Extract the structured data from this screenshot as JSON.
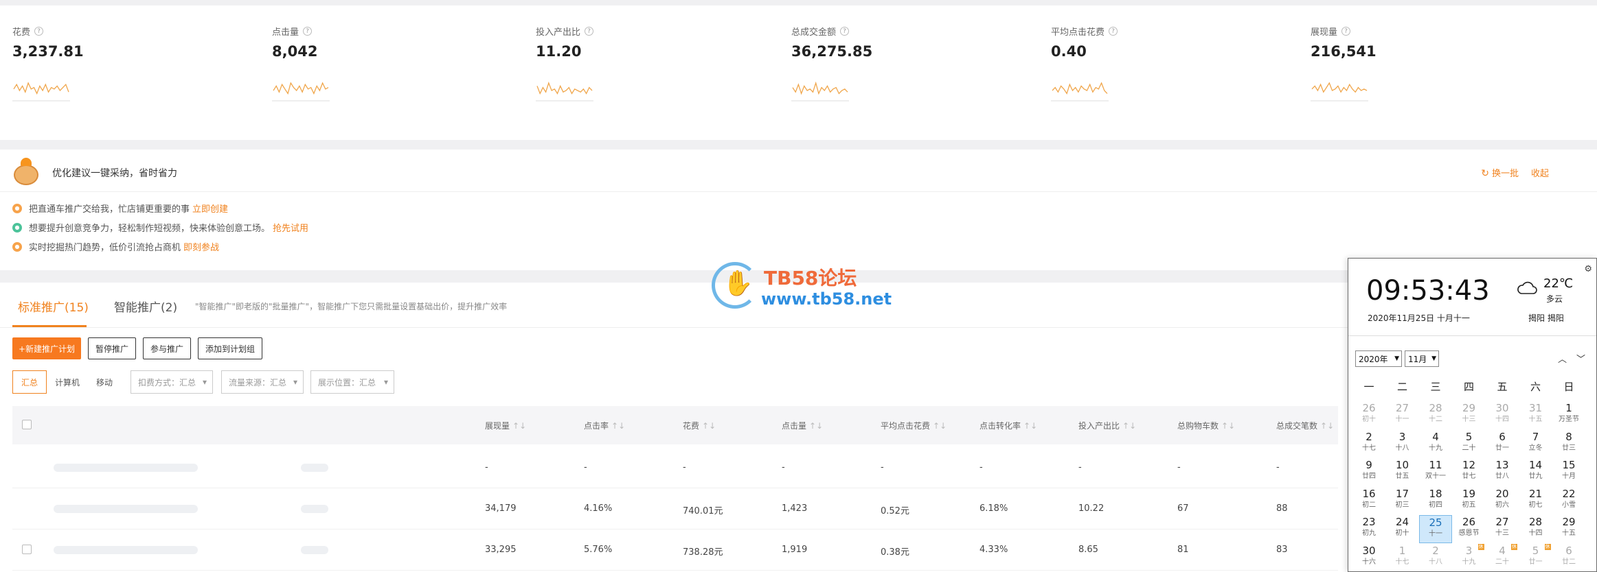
{
  "metrics": [
    {
      "label": "花费",
      "value": "3,237.81",
      "spark": [
        6,
        9,
        5,
        8,
        4,
        10,
        6,
        7,
        3,
        8,
        5,
        9,
        4,
        7,
        6,
        8,
        5,
        7,
        9,
        4
      ]
    },
    {
      "label": "点击量",
      "value": "8,042",
      "spark": [
        5,
        8,
        4,
        9,
        6,
        3,
        10,
        7,
        5,
        8,
        4,
        9,
        6,
        7,
        3,
        8,
        5,
        10,
        6,
        7
      ]
    },
    {
      "label": "投入产出比",
      "value": "11.20",
      "spark": [
        8,
        3,
        7,
        4,
        10,
        5,
        6,
        3,
        8,
        4,
        5,
        7,
        3,
        6,
        5,
        4,
        6,
        3,
        7,
        5
      ]
    },
    {
      "label": "总成交金额",
      "value": "36,275.85",
      "spark": [
        7,
        4,
        9,
        3,
        8,
        5,
        6,
        4,
        10,
        3,
        7,
        5,
        8,
        4,
        6,
        7,
        3,
        5,
        6,
        4
      ]
    },
    {
      "label": "平均点击花费",
      "value": "0.40",
      "spark": [
        5,
        7,
        4,
        8,
        6,
        3,
        9,
        5,
        7,
        4,
        8,
        6,
        5,
        9,
        4,
        7,
        6,
        10,
        5,
        3
      ]
    },
    {
      "label": "展现量",
      "value": "216,541",
      "spark": [
        6,
        8,
        5,
        9,
        4,
        7,
        10,
        5,
        6,
        8,
        4,
        7,
        5,
        9,
        6,
        4,
        7,
        5,
        6,
        5
      ]
    }
  ],
  "suggest": {
    "title": "优化建议一键采纳，省时省力",
    "refresh": "换一批",
    "collapse": "收起",
    "items": [
      {
        "text": "把直通车推广交给我，忙店铺更重要的事",
        "link": "立即创建"
      },
      {
        "text": "想要提升创意竞争力，轻松制作短视频，快来体验创意工场。",
        "link": "抢先试用"
      },
      {
        "text": "实时挖掘热门趋势，低价引流抢占商机",
        "link": "即刻参战"
      }
    ]
  },
  "tabs": {
    "standard": "标准推广(15)",
    "smart": "智能推广(2)",
    "note": "\"智能推广\"即老版的\"批量推广\"，智能推广下您只需批量设置基础出价，提升推广效率"
  },
  "buttons": {
    "new": "+新建推广计划",
    "pause": "暂停推广",
    "join": "参与推广",
    "add_label": "添加到计划组"
  },
  "filters": {
    "segments": [
      "汇总",
      "计算机",
      "移动"
    ],
    "deduct": "扣费方式：汇总",
    "source": "流量来源：汇总",
    "position": "展示位置：汇总"
  },
  "table": {
    "columns": [
      "展现量",
      "点击率",
      "花费",
      "点击量",
      "平均点击花费",
      "点击转化率",
      "投入产出比",
      "总购物车数",
      "总成交笔数"
    ],
    "sort": "↑↓",
    "rows": [
      [
        "-",
        "-",
        "-",
        "-",
        "-",
        "-",
        "-",
        "-",
        "-"
      ],
      [
        "34,179",
        "4.16%",
        "740.01元",
        "1,423",
        "0.52元",
        "6.18%",
        "10.22",
        "67",
        "88"
      ],
      [
        "33,295",
        "5.76%",
        "738.28元",
        "1,919",
        "0.38元",
        "4.33%",
        "8.65",
        "81",
        "83"
      ]
    ]
  },
  "watermark": {
    "title": "TB58论坛",
    "url": "www.tb58.net"
  },
  "calendar": {
    "time": "09:53:43",
    "date": "2020年11月25日  十月十一",
    "temp": "22℃",
    "cond": "多云",
    "loc": "揭阳 揭阳",
    "year_sel": "2020年",
    "month_sel": "11月",
    "weekdays": [
      "一",
      "二",
      "三",
      "四",
      "五",
      "六",
      "日"
    ],
    "days": [
      {
        "n": "26",
        "l": "初十",
        "dim": true
      },
      {
        "n": "27",
        "l": "十一",
        "dim": true
      },
      {
        "n": "28",
        "l": "十二",
        "dim": true
      },
      {
        "n": "29",
        "l": "十三",
        "dim": true
      },
      {
        "n": "30",
        "l": "十四",
        "dim": true
      },
      {
        "n": "31",
        "l": "十五",
        "dim": true
      },
      {
        "n": "1",
        "l": "万圣节"
      },
      {
        "n": "2",
        "l": "十七"
      },
      {
        "n": "3",
        "l": "十八"
      },
      {
        "n": "4",
        "l": "十九"
      },
      {
        "n": "5",
        "l": "二十"
      },
      {
        "n": "6",
        "l": "廿一"
      },
      {
        "n": "7",
        "l": "立冬"
      },
      {
        "n": "8",
        "l": "廿三"
      },
      {
        "n": "9",
        "l": "廿四"
      },
      {
        "n": "10",
        "l": "廿五"
      },
      {
        "n": "11",
        "l": "双十一"
      },
      {
        "n": "12",
        "l": "廿七"
      },
      {
        "n": "13",
        "l": "廿八"
      },
      {
        "n": "14",
        "l": "廿九"
      },
      {
        "n": "15",
        "l": "十月"
      },
      {
        "n": "16",
        "l": "初二"
      },
      {
        "n": "17",
        "l": "初三"
      },
      {
        "n": "18",
        "l": "初四"
      },
      {
        "n": "19",
        "l": "初五"
      },
      {
        "n": "20",
        "l": "初六"
      },
      {
        "n": "21",
        "l": "初七"
      },
      {
        "n": "22",
        "l": "小雪"
      },
      {
        "n": "23",
        "l": "初九"
      },
      {
        "n": "24",
        "l": "初十"
      },
      {
        "n": "25",
        "l": "十一",
        "today": true
      },
      {
        "n": "26",
        "l": "感恩节"
      },
      {
        "n": "27",
        "l": "十三"
      },
      {
        "n": "28",
        "l": "十四"
      },
      {
        "n": "29",
        "l": "十五"
      },
      {
        "n": "30",
        "l": "十六"
      },
      {
        "n": "1",
        "l": "十七",
        "dim": true
      },
      {
        "n": "2",
        "l": "十八",
        "dim": true
      },
      {
        "n": "3",
        "l": "十九",
        "dim": true,
        "badge": "休"
      },
      {
        "n": "4",
        "l": "二十",
        "dim": true,
        "badge": "休"
      },
      {
        "n": "5",
        "l": "廿一",
        "dim": true,
        "badge": "休"
      },
      {
        "n": "6",
        "l": "廿二",
        "dim": true
      }
    ]
  },
  "colors": {
    "accent": "#f0821e",
    "spark": "#f0a64b",
    "today": "#cfe8fb"
  }
}
